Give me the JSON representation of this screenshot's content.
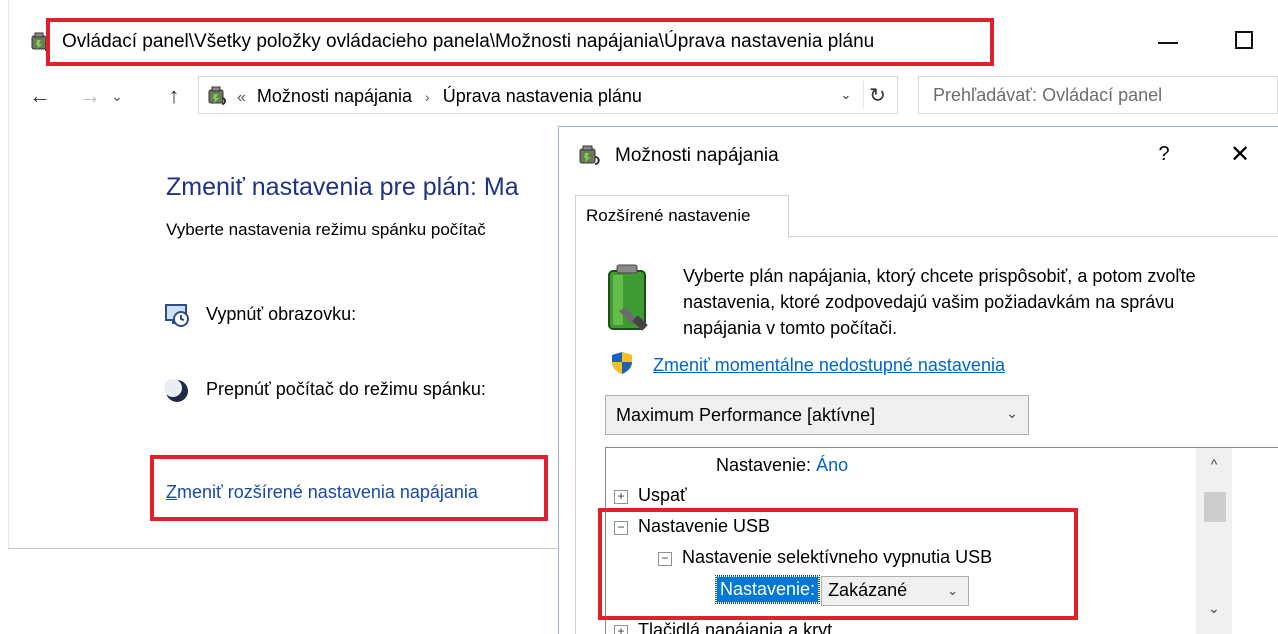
{
  "main_window": {
    "title": "Ovládací panel\\Všetky položky ovládacieho panela\\Možnosti napájania\\Úprava nastavenia plánu",
    "nav": {
      "back": "←",
      "forward": "→",
      "recent": "⌄",
      "up": "↑"
    },
    "address": {
      "overflow": "«",
      "crumbs": [
        "Možnosti napájania",
        "Úprava nastavenia plánu"
      ],
      "separator": "›",
      "dropdown": "⌄",
      "refresh": "↻"
    },
    "search_placeholder": "Prehľadávať: Ovládací panel",
    "content": {
      "title": "Zmeniť nastavenia pre plán: Ma",
      "subtitle": "Vyberte nastavenia režimu spánku počítač",
      "display_off_label": "Vypnúť obrazovku:",
      "sleep_label": "Prepnúť počítač do režimu spánku:",
      "advanced_link_first": "Z",
      "advanced_link_rest": "meniť rozšírené nastavenia napájania"
    }
  },
  "dialog": {
    "title": "Možnosti napájania",
    "help": "?",
    "close": "✕",
    "tab": "Rozšírené nastavenie",
    "intro": "Vyberte plán napájania, ktorý chcete prispôsobiť, a potom zvoľte nastavenia, ktoré zodpovedajú vašim požiadavkám na správu napájania v tomto počítači.",
    "change_link": "Zmeniť momentálne nedostupné nastavenia",
    "plan_select": "Maximum Performance [aktívne]",
    "tree": {
      "prev_setting_label": "Nastavenie:",
      "prev_setting_value": "Áno",
      "sleep": "Uspať",
      "usb_settings": "Nastavenie USB",
      "usb_selective": "Nastavenie selektívneho vypnutia USB",
      "setting_label": "Nastavenie:",
      "setting_value": "Zakázané",
      "power_buttons": "Tlačidlá napájania a kryt",
      "expand": "+",
      "collapse": "−"
    },
    "scroll_up": "^",
    "scroll_down": "⌄"
  },
  "colors": {
    "highlight": "#e0202c",
    "link": "#0066cc",
    "heading": "#1e3287",
    "selection": "#0078d7"
  }
}
